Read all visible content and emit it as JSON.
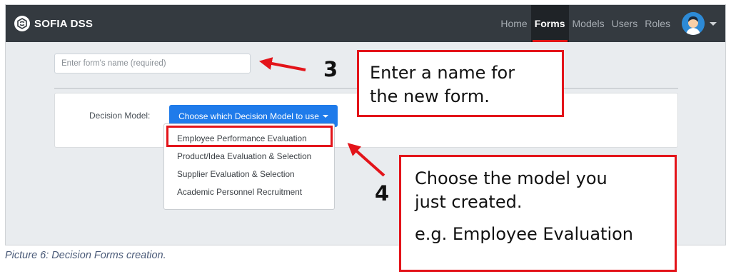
{
  "app": {
    "name": "SOFIA DSS",
    "logo_icon": "sofia-logo-icon"
  },
  "nav": {
    "items": [
      {
        "label": "Home",
        "active": false
      },
      {
        "label": "Forms",
        "active": true
      },
      {
        "label": "Models",
        "active": false
      },
      {
        "label": "Users",
        "active": false
      },
      {
        "label": "Roles",
        "active": false
      }
    ],
    "user_avatar_icon": "user-avatar-icon"
  },
  "form": {
    "name_placeholder": "Enter form's name (required)",
    "name_value": "",
    "decision_model_label": "Decision Model:",
    "dropdown_label": "Choose which Decision Model to use",
    "dropdown_options": [
      "Employee Performance Evaluation",
      "Product/Idea Evaluation & Selection",
      "Supplier Evaluation & Selection",
      "Academic Personnel Recruitment"
    ],
    "highlighted_option": "Employee Performance Evaluation"
  },
  "annotations": {
    "step3": {
      "number": "3",
      "lines": [
        "Enter a name for",
        "the new form."
      ]
    },
    "step4": {
      "number": "4",
      "lines": [
        "Choose the model you",
        "just created."
      ],
      "example": "e.g. Employee Evaluation"
    },
    "accent_color": "#e3141a"
  },
  "caption": "Picture 6: Decision Forms creation."
}
